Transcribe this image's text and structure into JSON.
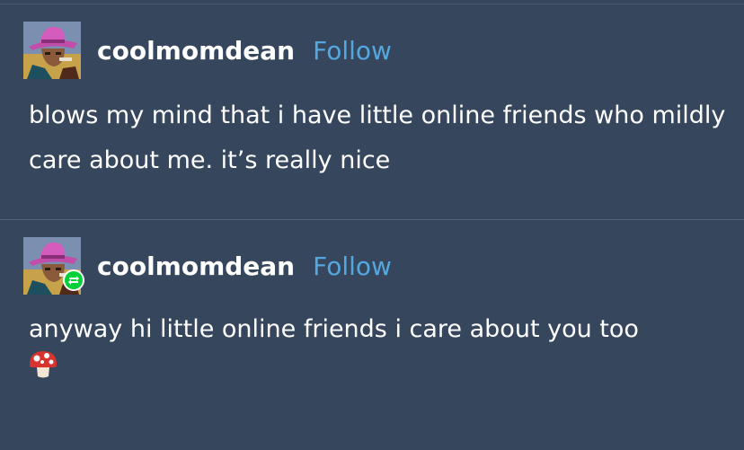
{
  "posts": [
    {
      "username": "coolmomdean",
      "follow_label": "Follow",
      "text": "blows my mind that i have little online friends who mildly care about me. it’s really nice",
      "reblog": false
    },
    {
      "username": "coolmomdean",
      "follow_label": "Follow",
      "text": "anyway hi little online friends i care about you too",
      "emoji": "mushroom",
      "reblog": true
    }
  ],
  "colors": {
    "background": "#36465d",
    "follow": "#54a8e0",
    "reblog_badge": "#00cf35"
  }
}
